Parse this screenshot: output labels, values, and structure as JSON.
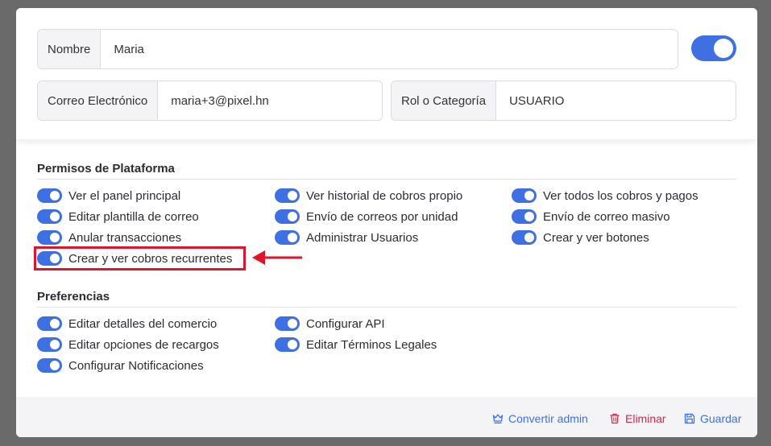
{
  "form": {
    "nombre_label": "Nombre",
    "nombre_value": "Maria",
    "correo_label": "Correo Electrónico",
    "correo_value": "maria+3@pixel.hn",
    "rol_label": "Rol o Categoría",
    "rol_value": "USUARIO",
    "active_toggle": true
  },
  "platform": {
    "title": "Permisos de Plataforma",
    "col1": [
      "Ver el panel principal",
      "Editar plantilla de correo",
      "Anular transacciones",
      "Crear y ver cobros recurrentes"
    ],
    "col2": [
      "Ver historial de cobros propio",
      "Envío de correos por unidad",
      "Administrar Usuarios"
    ],
    "col3": [
      "Ver todos los cobros y pagos",
      "Envío de correo masivo",
      "Crear y ver botones"
    ]
  },
  "preferences": {
    "title": "Preferencias",
    "col1": [
      "Editar detalles del comercio",
      "Editar opciones de recargos",
      "Configurar Notificaciones"
    ],
    "col2": [
      "Configurar API",
      "Editar Términos Legales"
    ]
  },
  "footer": {
    "admin_label": "Convertir admin",
    "delete_label": "Eliminar",
    "save_label": "Guardar"
  },
  "colors": {
    "accent": "#3e70e3",
    "danger": "#d6294a",
    "annotation": "#e0142a"
  },
  "icons": {
    "admin": "crown-icon",
    "delete": "trash-icon",
    "save": "save-icon",
    "annotation": "arrow-left-icon"
  }
}
